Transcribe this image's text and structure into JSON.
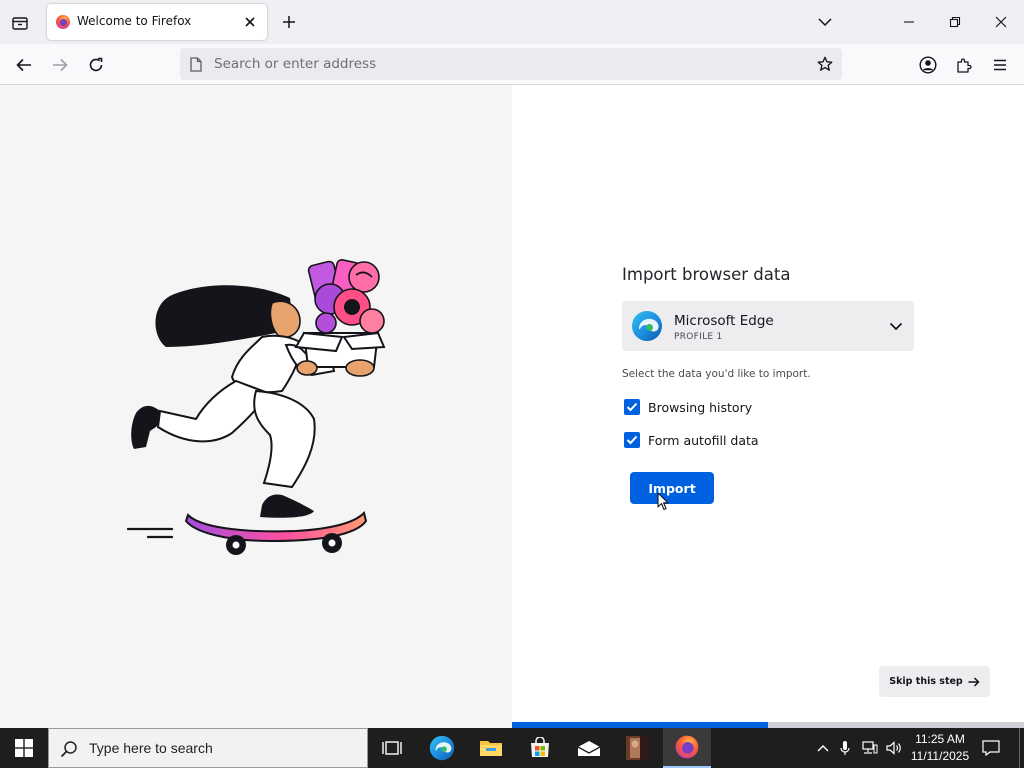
{
  "browser": {
    "tab": {
      "title": "Welcome to Firefox"
    },
    "url_placeholder": "Search or enter address"
  },
  "import_panel": {
    "heading": "Import browser data",
    "source": {
      "name": "Microsoft Edge",
      "profile": "PROFILE 1"
    },
    "hint": "Select the data you'd like to import.",
    "options": [
      {
        "label": "Browsing history",
        "checked": true
      },
      {
        "label": "Form autofill data",
        "checked": true
      }
    ],
    "import_label": "Import",
    "skip_label": "Skip this step",
    "progress_fraction": 0.5
  },
  "taskbar": {
    "search_placeholder": "Type here to search",
    "time": "11:25 AM",
    "date": "11/11/2025"
  },
  "colors": {
    "accent": "#0061e0"
  }
}
